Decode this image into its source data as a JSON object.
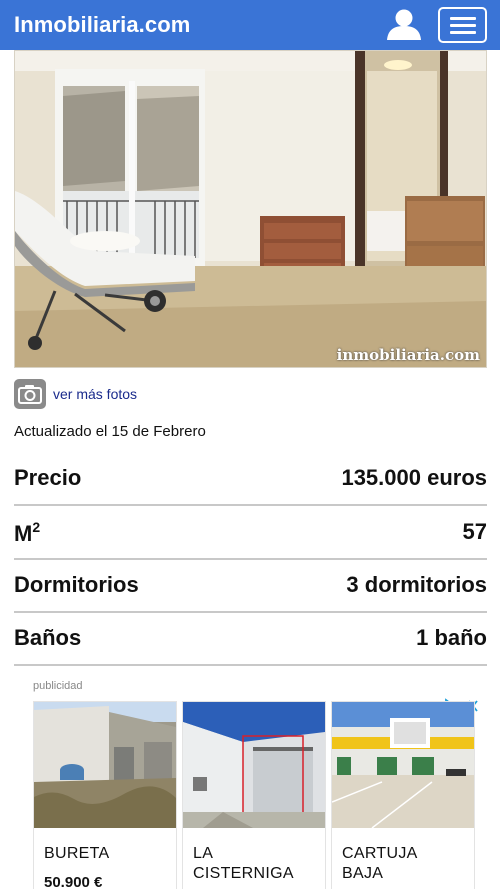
{
  "header": {
    "brand": "Inmobiliaria.com"
  },
  "photo": {
    "watermark": "inmobiliaria.com"
  },
  "more_photos": {
    "label": "ver más fotos"
  },
  "updated": "Actualizado el 15 de Febrero",
  "details": [
    {
      "label": "Precio",
      "value": "135.000 euros"
    },
    {
      "label": "M",
      "label_sup": "2",
      "value": "57"
    },
    {
      "label": "Dormitorios",
      "value": "3 dormitorios"
    },
    {
      "label": "Baños",
      "value": "1 baño"
    }
  ],
  "ads": {
    "label": "publicidad",
    "items": [
      {
        "title": "BURETA",
        "price": "50.900 €"
      },
      {
        "title_line1": "LA",
        "title_line2": "CISTERNIGA"
      },
      {
        "title_line1": "CARTUJA",
        "title_line2": "BAJA"
      }
    ]
  },
  "colors": {
    "header": "#3a74d6",
    "link": "#1a2b8c",
    "divider": "#c8c8c8"
  }
}
